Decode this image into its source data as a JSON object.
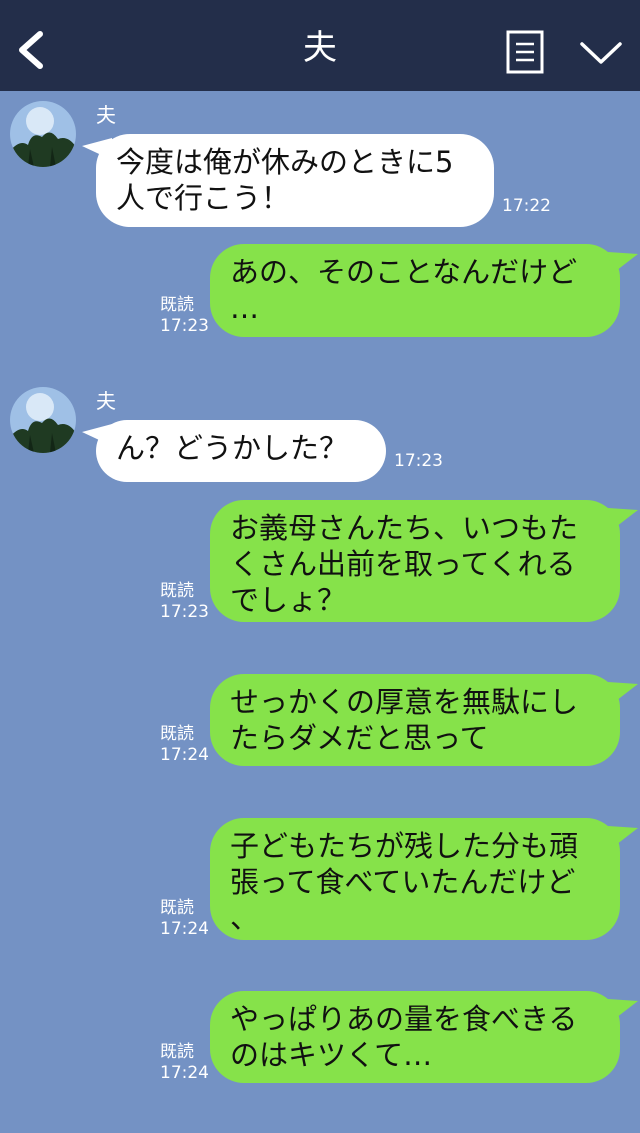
{
  "header": {
    "title": "夫",
    "back_icon": "chevron-left-icon",
    "menu_icon": "notes-icon",
    "collapse_icon": "chevron-down-icon"
  },
  "colors": {
    "header_bg": "#232e4a",
    "chat_bg": "#7492c4",
    "incoming_bubble": "#ffffff",
    "outgoing_bubble": "#86e24a"
  },
  "messages": [
    {
      "from": "夫",
      "direction": "in",
      "text": "今度は俺が休みのときに5\n人で行こう！",
      "time": "17:22"
    },
    {
      "direction": "out",
      "text": "あの、そのことなんだけど\n…",
      "read": "既読",
      "time": "17:23"
    },
    {
      "from": "夫",
      "direction": "in",
      "text": "ん？どうかした？",
      "time": "17:23"
    },
    {
      "direction": "out",
      "text": "お義母さんたち、いつもた\nくさん出前を取ってくれる\nでしょ？",
      "read": "既読",
      "time": "17:23"
    },
    {
      "direction": "out",
      "text": "せっかくの厚意を無駄にし\nたらダメだと思って",
      "read": "既読",
      "time": "17:24"
    },
    {
      "direction": "out",
      "text": "子どもたちが残した分も頑\n張って食べていたんだけど\n、",
      "read": "既読",
      "time": "17:24"
    },
    {
      "direction": "out",
      "text": "やっぱりあの量を食べきる\nのはキツくて…",
      "read": "既読",
      "time": "17:24"
    }
  ]
}
